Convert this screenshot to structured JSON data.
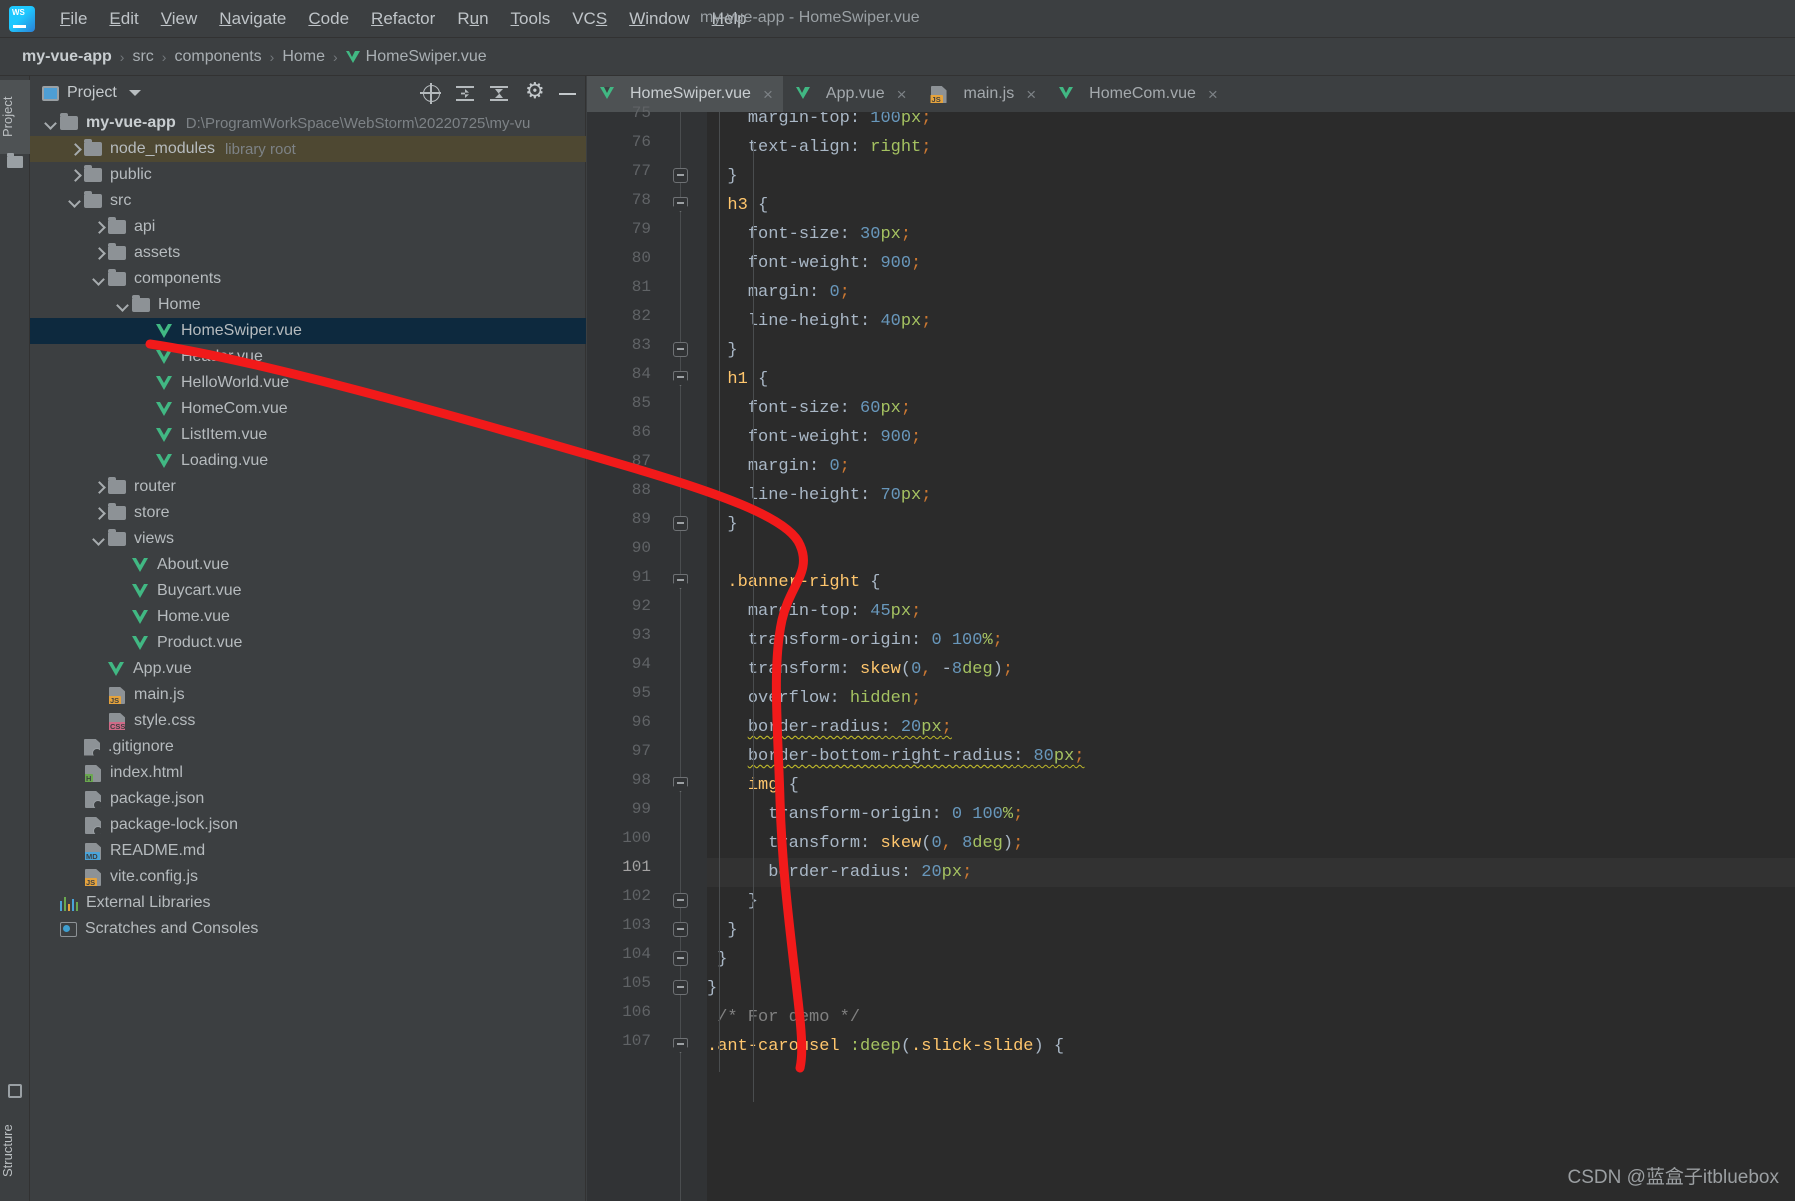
{
  "window": {
    "title": "my-vue-app - HomeSwiper.vue",
    "app_icon": "webstorm-logo"
  },
  "menu": [
    {
      "label": "File",
      "mnemonic": "F"
    },
    {
      "label": "Edit",
      "mnemonic": "E"
    },
    {
      "label": "View",
      "mnemonic": "V"
    },
    {
      "label": "Navigate",
      "mnemonic": "N"
    },
    {
      "label": "Code",
      "mnemonic": "C"
    },
    {
      "label": "Refactor",
      "mnemonic": "R"
    },
    {
      "label": "Run",
      "mnemonic": "u"
    },
    {
      "label": "Tools",
      "mnemonic": "T"
    },
    {
      "label": "VCS",
      "mnemonic": "S"
    },
    {
      "label": "Window",
      "mnemonic": "W"
    },
    {
      "label": "Help",
      "mnemonic": "H"
    }
  ],
  "breadcrumb": {
    "separator": "›",
    "items": [
      {
        "label": "my-vue-app",
        "bold": true,
        "icon": ""
      },
      {
        "label": "src",
        "bold": false,
        "icon": ""
      },
      {
        "label": "components",
        "bold": false,
        "icon": ""
      },
      {
        "label": "Home",
        "bold": false,
        "icon": ""
      },
      {
        "label": "HomeSwiper.vue",
        "bold": false,
        "icon": "vue-icon"
      }
    ]
  },
  "toolstrip": {
    "project_label": "Project",
    "structure_label": "Structure"
  },
  "project_panel": {
    "title": "Project",
    "tools": [
      {
        "name": "locate-icon",
        "label": ""
      },
      {
        "name": "expand-all-icon",
        "label": ""
      },
      {
        "name": "collapse-all-icon",
        "label": ""
      },
      {
        "name": "settings-gear-icon",
        "label": ""
      },
      {
        "name": "hide-panel-icon",
        "label": ""
      }
    ],
    "tree": [
      {
        "indent": 0,
        "arrow": "open",
        "icon": "folder",
        "label": "my-vue-app",
        "bold": true,
        "dim": "D:\\ProgramWorkSpace\\WebStorm\\20220725\\my-vu",
        "state": "none"
      },
      {
        "indent": 1,
        "arrow": "closed",
        "icon": "folder",
        "label": "node_modules",
        "bold": false,
        "dim": "library root",
        "state": "hl"
      },
      {
        "indent": 1,
        "arrow": "closed",
        "icon": "folder",
        "label": "public",
        "bold": false,
        "dim": "",
        "state": "none"
      },
      {
        "indent": 1,
        "arrow": "open",
        "icon": "folder",
        "label": "src",
        "bold": false,
        "dim": "",
        "state": "none"
      },
      {
        "indent": 2,
        "arrow": "closed",
        "icon": "folder",
        "label": "api",
        "bold": false,
        "dim": "",
        "state": "none"
      },
      {
        "indent": 2,
        "arrow": "closed",
        "icon": "folder",
        "label": "assets",
        "bold": false,
        "dim": "",
        "state": "none"
      },
      {
        "indent": 2,
        "arrow": "open",
        "icon": "folder",
        "label": "components",
        "bold": false,
        "dim": "",
        "state": "none"
      },
      {
        "indent": 3,
        "arrow": "open",
        "icon": "folder",
        "label": "Home",
        "bold": false,
        "dim": "",
        "state": "none"
      },
      {
        "indent": 4,
        "arrow": "none",
        "icon": "vue",
        "label": "HomeSwiper.vue",
        "bold": false,
        "dim": "",
        "state": "sel"
      },
      {
        "indent": 4,
        "arrow": "none",
        "icon": "vue",
        "label": "Header.vue",
        "bold": false,
        "dim": "",
        "state": "none"
      },
      {
        "indent": 4,
        "arrow": "none",
        "icon": "vue",
        "label": "HelloWorld.vue",
        "bold": false,
        "dim": "",
        "state": "none"
      },
      {
        "indent": 4,
        "arrow": "none",
        "icon": "vue",
        "label": "HomeCom.vue",
        "bold": false,
        "dim": "",
        "state": "none"
      },
      {
        "indent": 4,
        "arrow": "none",
        "icon": "vue",
        "label": "ListItem.vue",
        "bold": false,
        "dim": "",
        "state": "none"
      },
      {
        "indent": 4,
        "arrow": "none",
        "icon": "vue",
        "label": "Loading.vue",
        "bold": false,
        "dim": "",
        "state": "none"
      },
      {
        "indent": 2,
        "arrow": "closed",
        "icon": "folder",
        "label": "router",
        "bold": false,
        "dim": "",
        "state": "none"
      },
      {
        "indent": 2,
        "arrow": "closed",
        "icon": "folder",
        "label": "store",
        "bold": false,
        "dim": "",
        "state": "none"
      },
      {
        "indent": 2,
        "arrow": "open",
        "icon": "folder",
        "label": "views",
        "bold": false,
        "dim": "",
        "state": "none"
      },
      {
        "indent": 3,
        "arrow": "none",
        "icon": "vue",
        "label": "About.vue",
        "bold": false,
        "dim": "",
        "state": "none"
      },
      {
        "indent": 3,
        "arrow": "none",
        "icon": "vue",
        "label": "Buycart.vue",
        "bold": false,
        "dim": "",
        "state": "none"
      },
      {
        "indent": 3,
        "arrow": "none",
        "icon": "vue",
        "label": "Home.vue",
        "bold": false,
        "dim": "",
        "state": "none"
      },
      {
        "indent": 3,
        "arrow": "none",
        "icon": "vue",
        "label": "Product.vue",
        "bold": false,
        "dim": "",
        "state": "none"
      },
      {
        "indent": 2,
        "arrow": "none",
        "icon": "vue",
        "label": "App.vue",
        "bold": false,
        "dim": "",
        "state": "none"
      },
      {
        "indent": 2,
        "arrow": "none",
        "icon": "js",
        "label": "main.js",
        "bold": false,
        "dim": "",
        "state": "none"
      },
      {
        "indent": 2,
        "arrow": "none",
        "icon": "css",
        "label": "style.css",
        "bold": false,
        "dim": "",
        "state": "none"
      },
      {
        "indent": 1,
        "arrow": "none",
        "icon": "git",
        "label": ".gitignore",
        "bold": false,
        "dim": "",
        "state": "none"
      },
      {
        "indent": 1,
        "arrow": "none",
        "icon": "html",
        "label": "index.html",
        "bold": false,
        "dim": "",
        "state": "none"
      },
      {
        "indent": 1,
        "arrow": "none",
        "icon": "json",
        "label": "package.json",
        "bold": false,
        "dim": "",
        "state": "none"
      },
      {
        "indent": 1,
        "arrow": "none",
        "icon": "json",
        "label": "package-lock.json",
        "bold": false,
        "dim": "",
        "state": "none"
      },
      {
        "indent": 1,
        "arrow": "none",
        "icon": "md",
        "label": "README.md",
        "bold": false,
        "dim": "",
        "state": "none"
      },
      {
        "indent": 1,
        "arrow": "none",
        "icon": "js",
        "label": "vite.config.js",
        "bold": false,
        "dim": "",
        "state": "none"
      },
      {
        "indent": 0,
        "arrow": "none",
        "icon": "extlib",
        "label": "External Libraries",
        "bold": false,
        "dim": "",
        "state": "none"
      },
      {
        "indent": 0,
        "arrow": "none",
        "icon": "scratch",
        "label": "Scratches and Consoles",
        "bold": false,
        "dim": "",
        "state": "none"
      }
    ]
  },
  "editor": {
    "tabs": [
      {
        "label": "HomeSwiper.vue",
        "icon": "vue-icon",
        "active": true,
        "close": "×"
      },
      {
        "label": "App.vue",
        "icon": "vue-icon",
        "active": false,
        "close": "×"
      },
      {
        "label": "main.js",
        "icon": "js-icon",
        "active": false,
        "close": "×"
      },
      {
        "label": "HomeCom.vue",
        "icon": "vue-icon",
        "active": false,
        "close": "×"
      }
    ],
    "cursor_line": 101,
    "first_visible_line": 75,
    "lines": [
      {
        "n": 75,
        "fold": "none",
        "text": "    margin-top: 100px;",
        "clipped_top": true
      },
      {
        "n": 76,
        "fold": "none",
        "text": "    text-align: right;"
      },
      {
        "n": 77,
        "fold": "minus",
        "text": "  }"
      },
      {
        "n": 78,
        "fold": "arrowdn",
        "text": "  h3 {"
      },
      {
        "n": 79,
        "fold": "none",
        "text": "    font-size: 30px;"
      },
      {
        "n": 80,
        "fold": "none",
        "text": "    font-weight: 900;"
      },
      {
        "n": 81,
        "fold": "none",
        "text": "    margin: 0;"
      },
      {
        "n": 82,
        "fold": "none",
        "text": "    line-height: 40px;"
      },
      {
        "n": 83,
        "fold": "minus",
        "text": "  }"
      },
      {
        "n": 84,
        "fold": "arrowdn",
        "text": "  h1 {"
      },
      {
        "n": 85,
        "fold": "none",
        "text": "    font-size: 60px;"
      },
      {
        "n": 86,
        "fold": "none",
        "text": "    font-weight: 900;"
      },
      {
        "n": 87,
        "fold": "none",
        "text": "    margin: 0;"
      },
      {
        "n": 88,
        "fold": "none",
        "text": "    line-height: 70px;"
      },
      {
        "n": 89,
        "fold": "minus",
        "text": "  }"
      },
      {
        "n": 90,
        "fold": "none",
        "text": ""
      },
      {
        "n": 91,
        "fold": "arrowdn",
        "text": "  .banner-right {"
      },
      {
        "n": 92,
        "fold": "none",
        "text": "    margin-top: 45px;"
      },
      {
        "n": 93,
        "fold": "none",
        "text": "    transform-origin: 0 100%;"
      },
      {
        "n": 94,
        "fold": "none",
        "text": "    transform: skew(0, -8deg);"
      },
      {
        "n": 95,
        "fold": "none",
        "text": "    overflow: hidden;"
      },
      {
        "n": 96,
        "fold": "none",
        "text": "    border-radius: 20px;",
        "warning": true
      },
      {
        "n": 97,
        "fold": "none",
        "text": "    border-bottom-right-radius: 80px;",
        "warning": true
      },
      {
        "n": 98,
        "fold": "arrowdn",
        "text": "    img {"
      },
      {
        "n": 99,
        "fold": "none",
        "text": "      transform-origin: 0 100%;"
      },
      {
        "n": 100,
        "fold": "none",
        "text": "      transform: skew(0, 8deg);"
      },
      {
        "n": 101,
        "fold": "none",
        "text": "      border-radius: 20px;"
      },
      {
        "n": 102,
        "fold": "minus",
        "text": "    }"
      },
      {
        "n": 103,
        "fold": "minus",
        "text": "  }"
      },
      {
        "n": 104,
        "fold": "minus",
        "text": " }"
      },
      {
        "n": 105,
        "fold": "minus",
        "text": "}"
      },
      {
        "n": 106,
        "fold": "none",
        "text": " /* For demo */"
      },
      {
        "n": 107,
        "fold": "arrowdn",
        "text": ".ant-carousel :deep(.slick-slide) {"
      }
    ]
  },
  "annotation": {
    "color": "#f11a1a",
    "description": "red-curved-arrow-from-homeswiper-to-banner-right"
  },
  "watermark": {
    "text": "CSDN @蓝盒子itbluebox"
  },
  "colors": {
    "bg_panel": "#3c3f41",
    "bg_editor": "#2b2b2b",
    "bg_gutter": "#313335",
    "selection": "#0d293e",
    "highlight": "#4e4832",
    "vue_green": "#41b883",
    "accent_blue": "#4e9ed4"
  }
}
